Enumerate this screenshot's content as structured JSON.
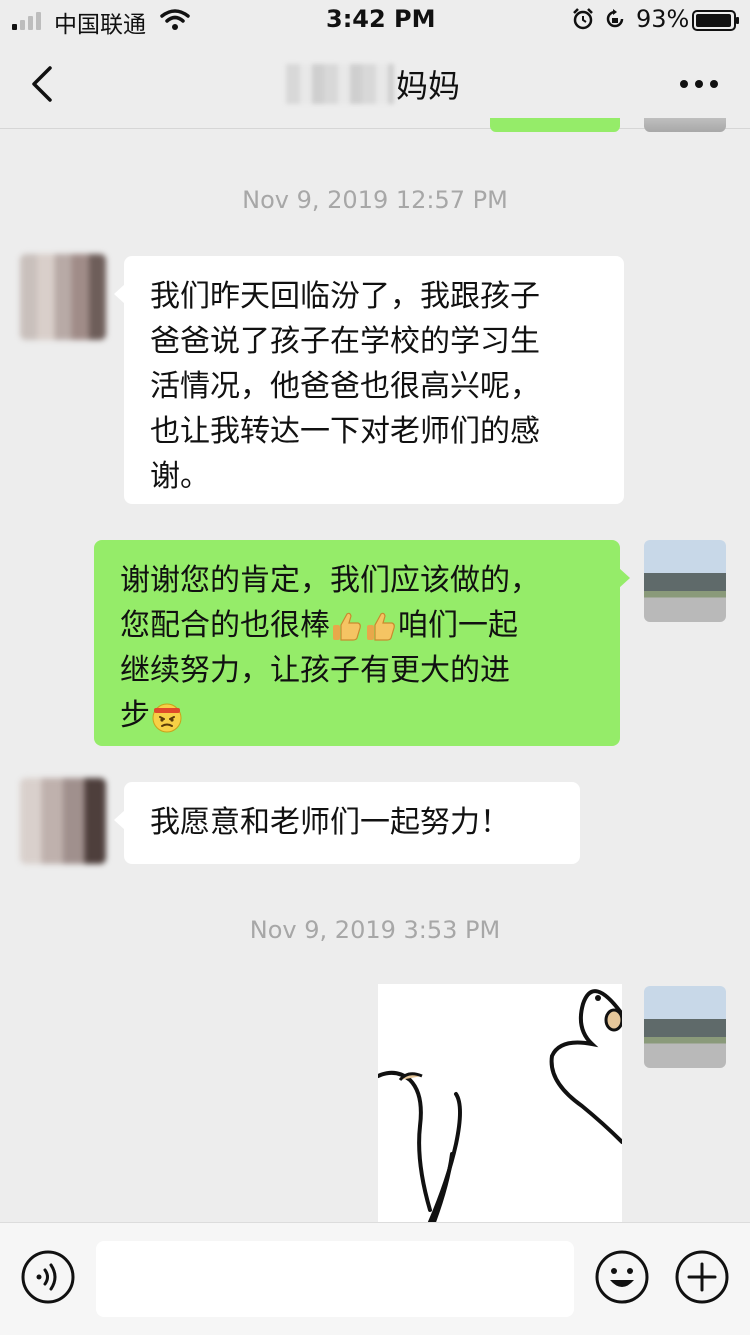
{
  "status_bar": {
    "carrier": "中国联通",
    "time": "3:42 PM",
    "battery_percent": "93%",
    "icons": [
      "signal-icon",
      "wifi-icon",
      "alarm-icon",
      "rotation-lock-icon",
      "battery-icon"
    ]
  },
  "nav": {
    "title": "妈妈",
    "back_icon": "chevron-left-icon",
    "more_icon": "more-dots-icon"
  },
  "messages": [
    {
      "type": "timestamp",
      "text": "Nov 9, 2019 12:57 PM"
    },
    {
      "type": "incoming",
      "lines": [
        "我们昨天回临汾了，我跟孩子",
        "爸爸说了孩子在学校的学习生",
        "活情况，他爸爸也很高兴呢，",
        "也让我转达一下对老师们的感",
        "谢。"
      ]
    },
    {
      "type": "outgoing",
      "line1": "谢谢您的肯定，我们应该做的，",
      "line2_before": "您配合的也很棒",
      "line2_after": "咱们一起",
      "line3": "继续努力，让孩子有更大的进",
      "line4": "步",
      "emojis": [
        "thumbs-up-emoji",
        "thumbs-up-emoji",
        "determined-face-emoji"
      ]
    },
    {
      "type": "incoming",
      "text": "我愿意和老师们一起努力！"
    },
    {
      "type": "timestamp",
      "text": "Nov 9, 2019 3:53 PM"
    },
    {
      "type": "outgoing_sticker",
      "sticker": "duck-sticker"
    }
  ],
  "input_bar": {
    "voice_icon": "voice-icon",
    "emoji_icon": "emoji-icon",
    "plus_icon": "plus-icon",
    "input_value": ""
  },
  "colors": {
    "background": "#ededed",
    "incoming_bubble": "#ffffff",
    "outgoing_bubble": "#95ec69",
    "timestamp_text": "#a7a7a7"
  }
}
